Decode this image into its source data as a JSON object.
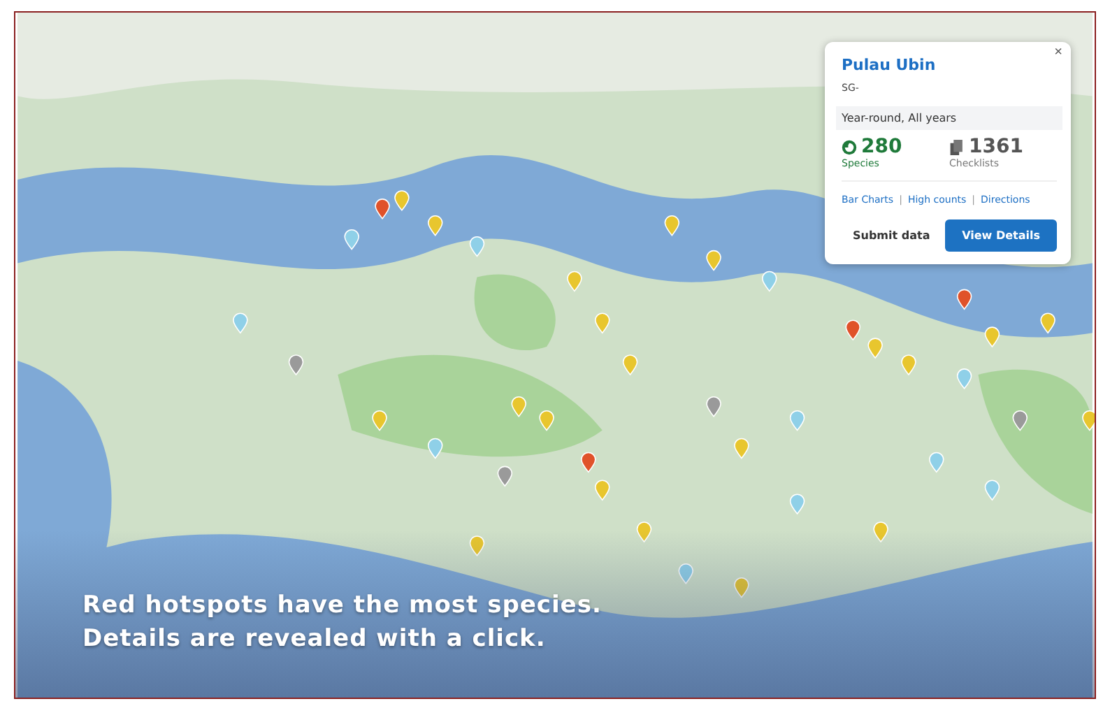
{
  "popup": {
    "close": "×",
    "title": "Pulau Ubin",
    "subtitle": "SG-",
    "period": "Year-round, All years",
    "stats": [
      {
        "kind": "species",
        "value": "280",
        "label": "Species"
      },
      {
        "kind": "checklists",
        "value": "1361",
        "label": "Checklists"
      }
    ],
    "links": [
      "Bar Charts",
      "High counts",
      "Directions"
    ],
    "separators": [
      "|",
      "|"
    ],
    "buttons": [
      {
        "kind": "secondary",
        "label": "Submit data"
      },
      {
        "kind": "primary",
        "label": "View Details"
      }
    ]
  },
  "caption": [
    "Red hotspots have the most species.",
    "Details are revealed with a click."
  ]
}
